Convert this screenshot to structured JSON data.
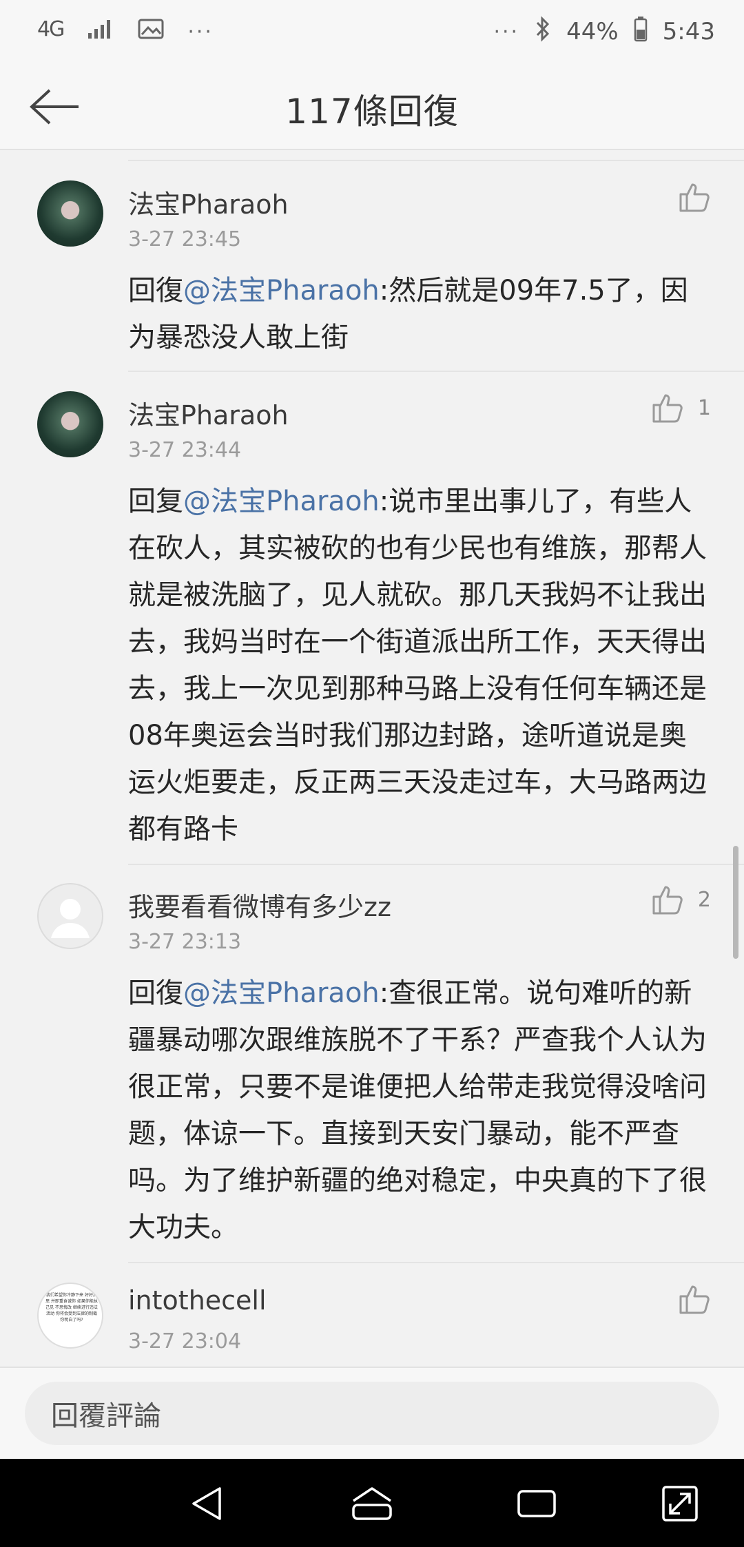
{
  "status_bar": {
    "network": "4G",
    "battery_percent": "44%",
    "time": "5:43",
    "icons": [
      "signal-icon",
      "image-icon",
      "more-dots-icon",
      "bluetooth-icon",
      "battery-icon"
    ],
    "more_left": "···",
    "more_right": "···"
  },
  "header": {
    "title": "117條回復",
    "back_icon": "back-arrow-icon"
  },
  "comments": [
    {
      "name": "法宝Pharaoh",
      "time": "3-27 23:45",
      "prefix": "回復",
      "mention": "@法宝Pharaoh",
      "text": ":然后就是09年7.5了，因为暴恐没人敢上街",
      "likes": "",
      "avatar": "dark"
    },
    {
      "name": "法宝Pharaoh",
      "time": "3-27 23:44",
      "prefix": "回复",
      "mention": "@法宝Pharaoh",
      "text": ":说市里出事儿了，有些人在砍人，其实被砍的也有少民也有维族，那帮人就是被洗脑了，见人就砍。那几天我妈不让我出去，我妈当时在一个街道派出所工作，天天得出去，我上一次见到那种马路上没有任何车辆还是08年奥运会当时我们那边封路，途听道说是奥运火炬要走，反正两三天没走过车，大马路两边都有路卡",
      "likes": "1",
      "avatar": "dark"
    },
    {
      "name": "我要看看微博有多少zz",
      "time": "3-27 23:13",
      "prefix": "回復",
      "mention": "@法宝Pharaoh",
      "text": ":查很正常。说句难听的新疆暴动哪次跟维族脱不了干系？严查我个人认为很正常，只要不是谁便把人给带走我觉得没啥问题，体谅一下。直接到天安门暴动，能不严查吗。为了维护新疆的绝对稳定，中央真的下了很大功夫。",
      "likes": "2",
      "avatar": "grey"
    },
    {
      "name": "intothecell",
      "time": "3-27 23:04",
      "likes": "",
      "avatar": "text",
      "avatar_text": "我们希望你冷静下来 好好反思 并即重食诚你 如果你能执己见 不思悔改 继续进行违法活动 你将会受到法律的制裁 你明白了吗?"
    }
  ],
  "reply_bar": {
    "placeholder": "回覆評論"
  },
  "nav_bar": {
    "icons": [
      "nav-back-icon",
      "nav-home-icon",
      "nav-recents-icon",
      "nav-expand-icon"
    ]
  },
  "colors": {
    "mention": "#4a72a6",
    "background": "#f2f2f2",
    "text": "#262626",
    "meta": "#9b9b9b"
  }
}
